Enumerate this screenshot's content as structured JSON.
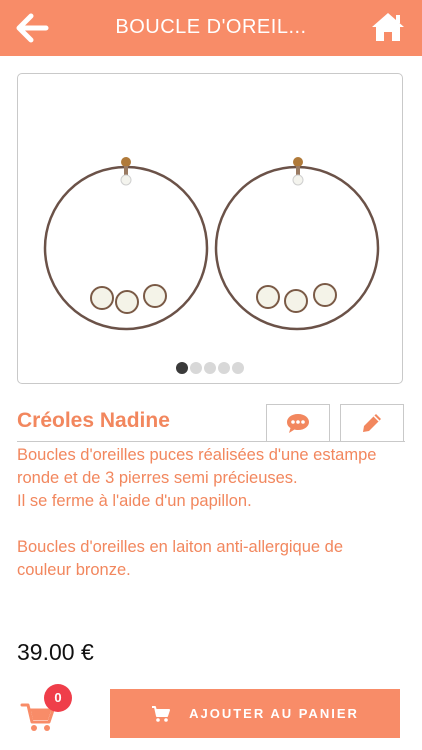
{
  "header": {
    "title": "BOUCLE D'OREIL...",
    "back_icon": "back-arrow-icon",
    "home_icon": "home-icon"
  },
  "product": {
    "title": "Créoles Nadine",
    "description": [
      "Boucles d'oreilles puces réalisées d'une estampe ronde et de 3 pierres semi précieuses.",
      "Il se ferme à l'aide d'un papillon.",
      "Boucles d'oreilles en laiton anti-allergique de couleur bronze."
    ],
    "price": "39.00 €"
  },
  "gallery": {
    "image_count": 5,
    "active_index": 0
  },
  "actions": {
    "comment_icon": "comment-icon",
    "edit_icon": "pencil-icon"
  },
  "cart": {
    "count": "0",
    "icon": "cart-icon",
    "add_label": "AJOUTER AU PANIER"
  },
  "colors": {
    "accent": "#f88c68",
    "text_accent": "#f2875e",
    "badge": "#ef3e4a"
  }
}
